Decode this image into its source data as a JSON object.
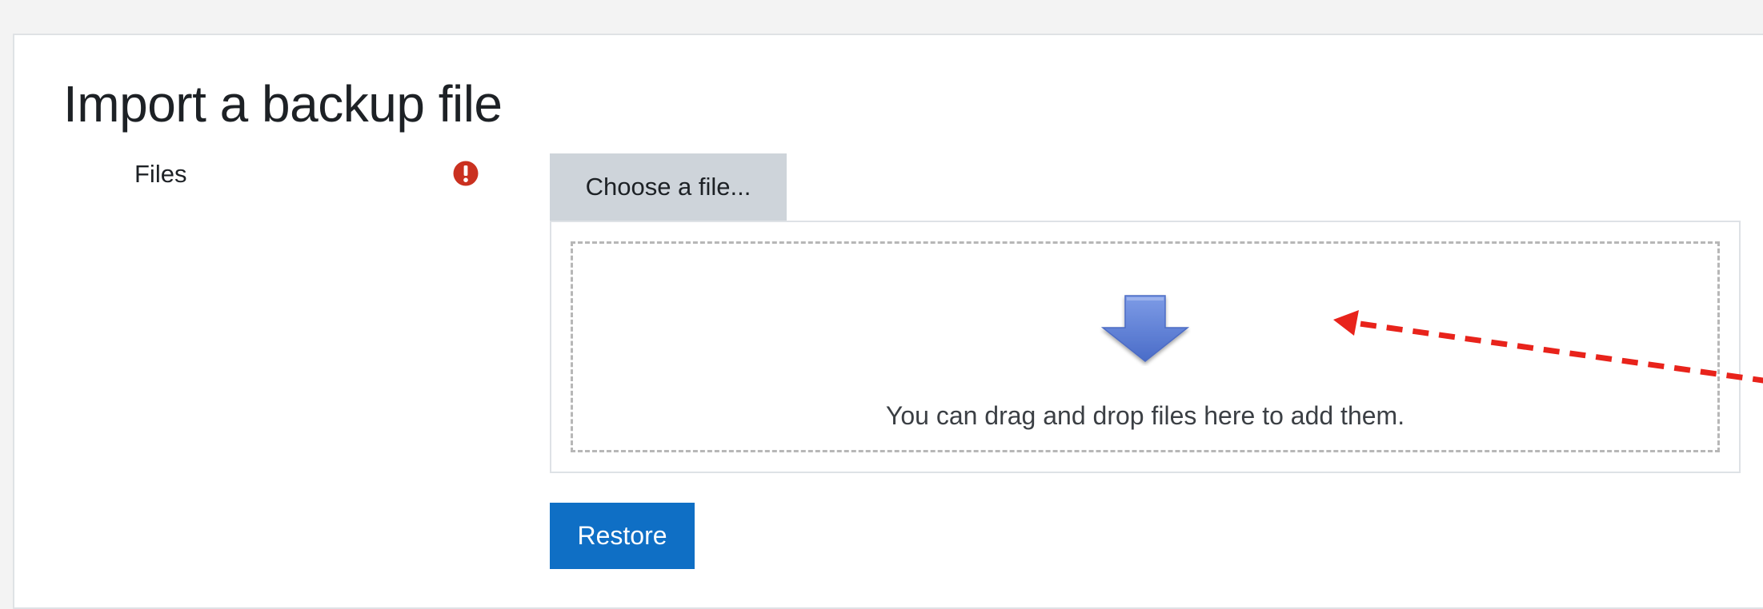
{
  "page": {
    "title": "Import a backup file"
  },
  "form": {
    "files_label": "Files",
    "required_icon": "exclamation-circle-icon",
    "choose_file_label": "Choose a file...",
    "drop_message": "You can drag and drop files here to add them.",
    "drop_icon": "down-arrow-icon",
    "restore_label": "Restore"
  },
  "annotation": {
    "icon": "dashed-arrow-icon",
    "color": "#e8231b"
  },
  "colors": {
    "required": "#ca3120",
    "primary": "#0f6fc5",
    "choose_button_bg": "#ced4da",
    "drop_arrow": "#5b7fd6"
  }
}
